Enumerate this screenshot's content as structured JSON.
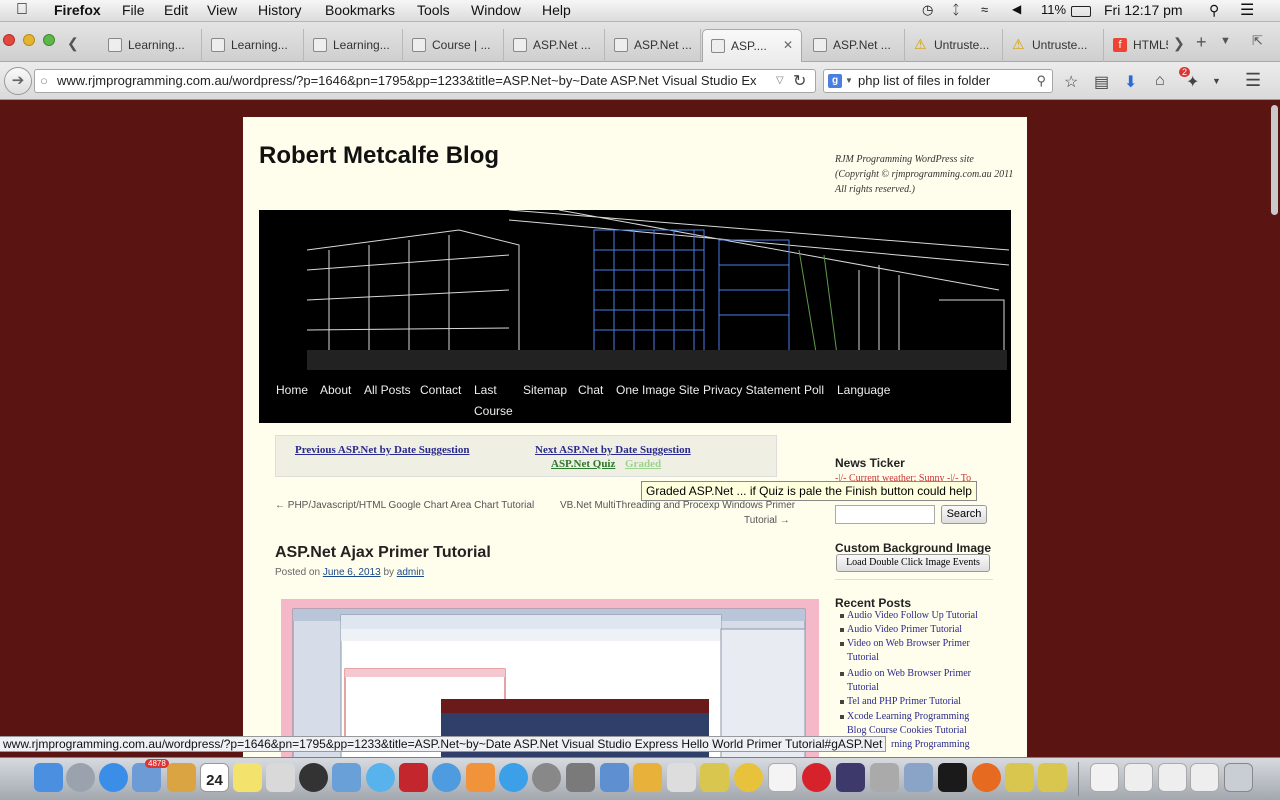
{
  "menubar": {
    "app": "Firefox",
    "items": [
      "File",
      "Edit",
      "View",
      "History",
      "Bookmarks",
      "Tools",
      "Window",
      "Help"
    ],
    "battery": "11%",
    "clock": "Fri 12:17 pm"
  },
  "tabs": [
    {
      "label": "Learning..."
    },
    {
      "label": "Learning..."
    },
    {
      "label": "Learning..."
    },
    {
      "label": "Course | ..."
    },
    {
      "label": "ASP.Net ..."
    },
    {
      "label": "ASP.Net ..."
    },
    {
      "label": "ASP...."
    },
    {
      "label": "ASP.Net ..."
    },
    {
      "label": "Untruste..."
    },
    {
      "label": "Untruste..."
    },
    {
      "label": "HTML5"
    }
  ],
  "url": "www.rjmprogramming.com.au/wordpress/?p=1646&pn=1795&pp=1233&title=ASP.Net~by~Date ASP.Net Visual Studio Ex",
  "search_query": "php list of files in folder",
  "downloads_badge": "2",
  "site": {
    "title": "Robert Metcalfe Blog",
    "description": "RJM Programming WordPress site (Copyright © rjmprogramming.com.au 2011 All rights reserved.)"
  },
  "nav_items": [
    "Home",
    "About",
    "All Posts",
    "Contact",
    "Last",
    "Course",
    "Sitemap",
    "Chat",
    "One Image Site",
    "Privacy Statement",
    "Poll",
    "Language"
  ],
  "suggestions": {
    "previous": "Previous ASP.Net by Date Suggestion",
    "next": "Next ASP.Net by Date Suggestion",
    "quiz": "ASP.Net Quiz",
    "graded": "Graded"
  },
  "tooltip": "Graded ASP.Net ... if Quiz is pale the Finish button could help",
  "post_nav": {
    "prev": "← PHP/Javascript/HTML Google Chart Area Chart Tutorial",
    "next_line1": "VB.Net MultiThreading and Procexp Windows Primer",
    "next_line2": "Tutorial →"
  },
  "post": {
    "title": "ASP.Net Ajax Primer Tutorial",
    "posted_on": "Posted on",
    "date": "June 6, 2013",
    "by": "by",
    "author": "admin"
  },
  "sidebar": {
    "news_title": "News Ticker",
    "news_text": "-|/- Current weather: Sunny -|/- To",
    "search_button": "Search",
    "bg_title": "Custom Background Image",
    "bg_button": "Load Double Click Image Events",
    "recent_title": "Recent Posts",
    "recent": [
      "Audio Video Follow Up Tutorial",
      "Audio Video Primer Tutorial",
      "Video on Web Browser Primer",
      "Tutorial",
      "Audio on Web Browser Primer",
      "Tutorial",
      "Tel and PHP Primer Tutorial",
      "Xcode Learning Programming",
      "Blog Course Cookies Tutorial",
      "rning Programming"
    ]
  },
  "status_url": "www.rjmprogramming.com.au/wordpress/?p=1646&pn=1795&pp=1233&title=ASP.Net~by~Date ASP.Net Visual Studio Express Hello World Primer Tutorial#gASP.Net",
  "dock": {
    "mail_badge": "4878",
    "calendar_day": "24"
  },
  "colors": {
    "page_bg": "#5a1512",
    "content_bg": "#fffdec",
    "link": "#2a2a8e",
    "quiz_green": "#2a7a2a",
    "graded_green": "#9dd38d"
  }
}
